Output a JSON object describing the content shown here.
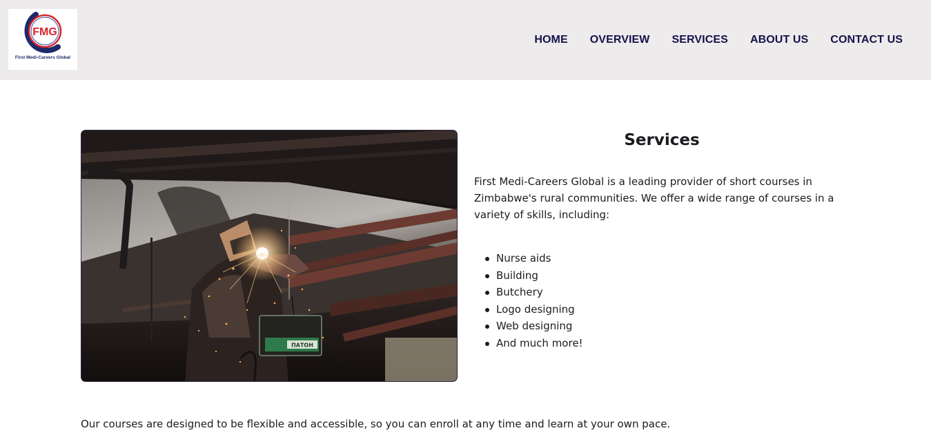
{
  "header": {
    "logo": {
      "initials": "FMG",
      "caption": "First Medi-Careers Global"
    },
    "nav": [
      {
        "label": "HOME"
      },
      {
        "label": "OVERVIEW"
      },
      {
        "label": "SERVICES"
      },
      {
        "label": "ABOUT US"
      },
      {
        "label": "CONTACT US"
      }
    ]
  },
  "main": {
    "title": "Services",
    "intro": "First Medi-Careers Global is a leading provider of short courses in Zimbabwe's rural communities. We offer a wide range of courses in a variety of skills, including:",
    "skills": [
      {
        "label": "Nurse aids"
      },
      {
        "label": "Building"
      },
      {
        "label": "Butchery"
      },
      {
        "label": "Logo designing"
      },
      {
        "label": "Web designing"
      },
      {
        "label": "And much more!"
      }
    ],
    "photo_device_label": "ПАТОН",
    "footer": "Our courses are designed to be flexible and accessible, so you can enroll at any time and learn at your own pace."
  },
  "colors": {
    "header_bg": "#edebec",
    "nav_text": "#14124a",
    "logo_red": "#d8262b",
    "logo_navy": "#1c2a6b",
    "body_text": "#1b1b1f"
  }
}
